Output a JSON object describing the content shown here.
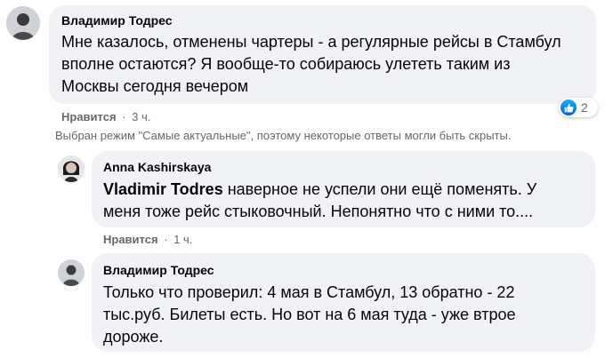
{
  "comments": [
    {
      "author": "Владимир Тодрес",
      "text_lines": [
        "Мне казалось, отменены чартеры - а регулярные рейсы в Стамбул",
        "вполне остаются? Я вообще-то собираюсь улететь таким из",
        "Москвы сегодня вечером"
      ],
      "like_label": "Нравится",
      "time": "3 ч.",
      "reactions": {
        "icon": "like-icon",
        "count": "2"
      }
    },
    {
      "author": "Anna Kashirskaya",
      "mention": "Vladimir Todres",
      "text_line1_rest": " наверное не успели они ещё поменять. У",
      "text_line2": "меня тоже рейс стыковочный. Непонятно что с ними то....",
      "like_label": "Нравится",
      "time": "1 ч."
    },
    {
      "author": "Владимир Тодрес",
      "text_lines": [
        "Только что проверил: 4 мая в Стамбул, 13 обратно - 22",
        "тыс.руб. Билеты есть. Но вот на 6 мая туда - уже втрое",
        "дороже."
      ]
    }
  ],
  "filter_note": "Выбран режим \"Самые актуальные\", поэтому некоторые ответы могли быть скрыты.",
  "separator": "·",
  "colors": {
    "bubble": "#f0f2f5",
    "meta_text": "#65676b",
    "like_blue": "#1877f2"
  }
}
